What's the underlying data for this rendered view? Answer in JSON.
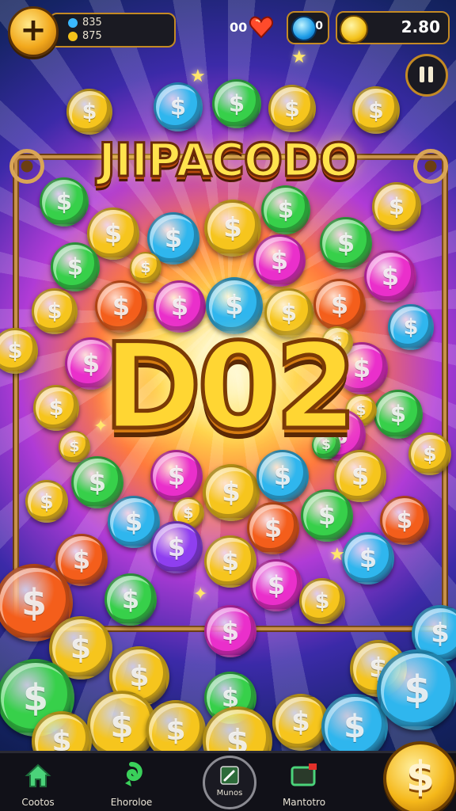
{
  "top_bar": {
    "add_button_label": "+",
    "stats": {
      "line1": "835",
      "line2": "875"
    },
    "lives_value": "00",
    "gems_value": "0",
    "coins_value": "2.80"
  },
  "title_banner": "JIIPACODO",
  "center_text": "D02",
  "coin_symbol": "$",
  "coin_colors": {
    "gold": "#f6c51d",
    "green": "#37d04a",
    "blue": "#2fb6ee",
    "magenta": "#ea2fcb",
    "orange": "#f45e1b",
    "purple": "#8f3ff0"
  },
  "bottom_nav": [
    {
      "label": "Cootos",
      "icon": "home-icon"
    },
    {
      "label": "Ehoroloe",
      "icon": "swirl-icon"
    },
    {
      "label": "Munos",
      "icon": "pencil-icon"
    },
    {
      "label": "Mantotro",
      "icon": "tv-icon"
    }
  ],
  "collect_button_label": "$"
}
